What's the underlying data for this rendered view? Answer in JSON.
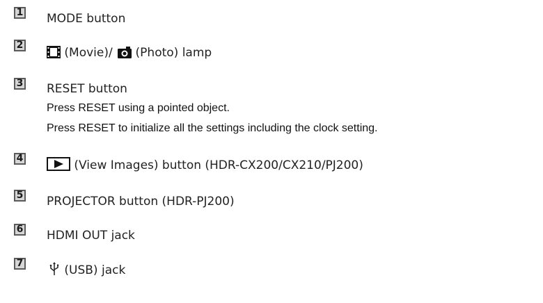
{
  "items": [
    {
      "number": "1",
      "label": "MODE button"
    },
    {
      "number": "2",
      "label_movie": "(Movie)/",
      "label_photo": "(Photo) lamp",
      "icon_movie": "film-icon",
      "icon_photo": "camera-icon"
    },
    {
      "number": "3",
      "label": "RESET button",
      "notes": [
        "Press RESET using a pointed object.",
        "Press RESET to initialize all the settings including the clock setting."
      ]
    },
    {
      "number": "4",
      "label": "(View Images) button (HDR-CX200/CX210/PJ200)",
      "icon": "play-icon"
    },
    {
      "number": "5",
      "label": "PROJECTOR button (HDR-PJ200)"
    },
    {
      "number": "6",
      "label": "HDMI OUT jack"
    },
    {
      "number": "7",
      "label": "(USB) jack",
      "icon": "usb-icon"
    }
  ]
}
